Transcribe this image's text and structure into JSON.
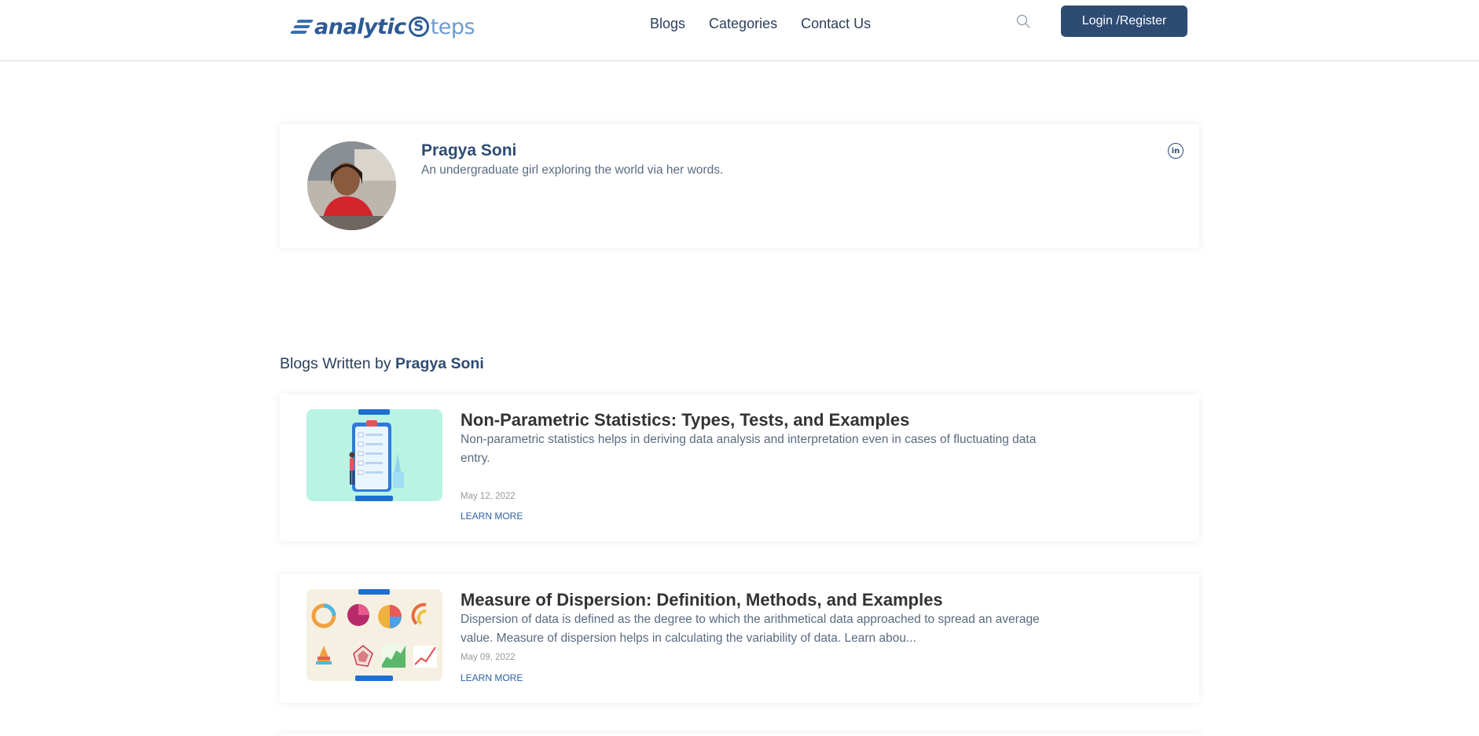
{
  "header": {
    "logo_part1": "analytic",
    "logo_s": "S",
    "logo_part2": "teps",
    "nav": [
      "Blogs",
      "Categories",
      "Contact Us"
    ],
    "login_label": "Login /Register"
  },
  "profile": {
    "name": "Pragya Soni",
    "bio": "An undergraduate girl exploring the world via her words."
  },
  "section": {
    "prefix": "Blogs Written by ",
    "author": "Pragya Soni"
  },
  "blogs": [
    {
      "title": "Non-Parametric Statistics: Types, Tests, and Examples",
      "description": "Non-parametric statistics helps in deriving data analysis and interpretation even in cases of fluctuating data entry.",
      "date": "May 12, 2022",
      "cta": "LEARN MORE"
    },
    {
      "title": "Measure of Dispersion: Definition, Methods, and Examples",
      "description": "Dispersion of data is defined as the degree to which the arithmetical data approached to spread an average value. Measure of dispersion helps in calculating the variability of data. Learn abou...",
      "date": "May 09, 2022",
      "cta": "LEARN MORE"
    }
  ],
  "colors": {
    "primary": "#2e4b73",
    "link": "#2d63a8",
    "thumb1_bg": "#b8f3e3",
    "thumb2_bg": "#f6f0e2"
  }
}
